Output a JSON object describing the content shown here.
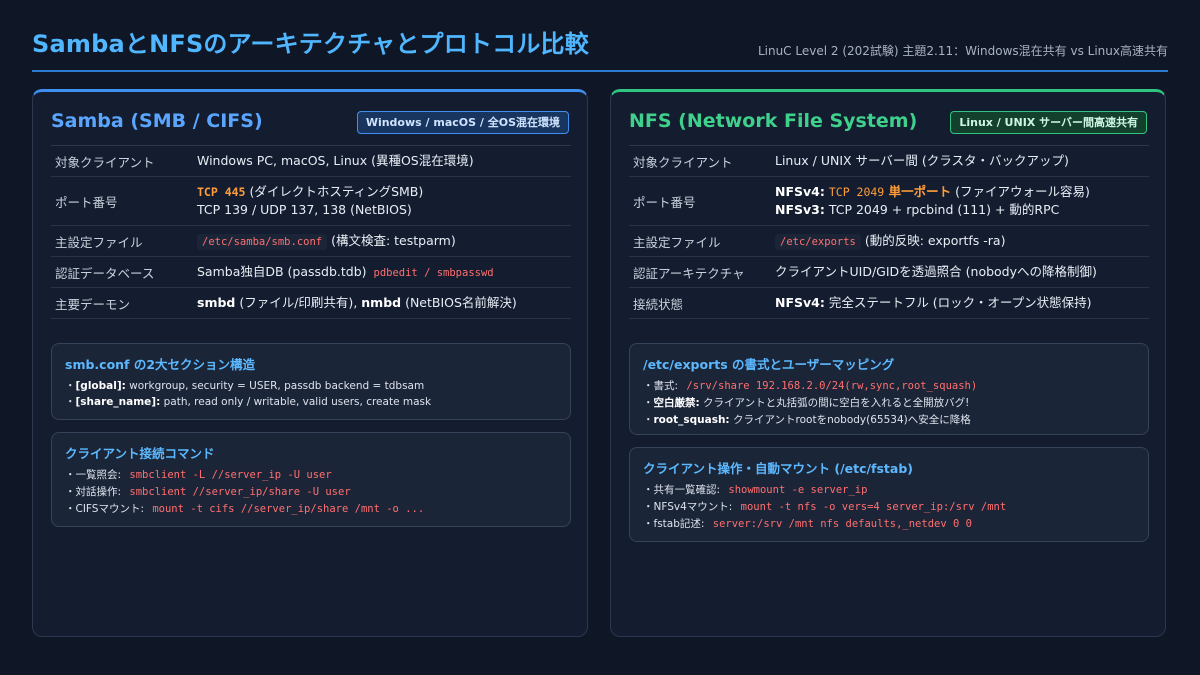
{
  "header": {
    "title": "SambaとNFSのアーキテクチャとプロトコル比較",
    "subtitle": "LinuC Level 2 (202試験) 主題2.11：Windows混在共有 vs Linux高速共有"
  },
  "samba": {
    "title": "Samba (SMB / CIFS)",
    "tag": "Windows / macOS / 全OS混在環境",
    "rows": {
      "client": {
        "key": "対象クライアント",
        "val": "Windows PC, macOS, Linux (異種OS混在環境)"
      },
      "port": {
        "key": "ポート番号",
        "tcp": "TCP 445",
        "tcp_note": " (ダイレクトホスティングSMB)",
        "line2": "TCP 139 / UDP 137, 138 (NetBIOS)"
      },
      "config": {
        "key": "主設定ファイル",
        "code": "/etc/samba/smb.conf",
        "note": " (構文検査: testparm)"
      },
      "auth": {
        "key": "認証データベース",
        "val": "Samba独自DB (passdb.tdb) ",
        "code": "pdbedit / smbpasswd"
      },
      "daemon": {
        "key": "主要デーモン",
        "b1": "smbd",
        "t1": " (ファイル/印刷共有), ",
        "b2": "nmbd",
        "t2": " (NetBIOS名前解決)"
      }
    },
    "box1": {
      "title": "smb.conf の2大セクション構造",
      "l1_label": "[global]:",
      "l1_text": " workgroup, security = USER, passdb backend = tdbsam",
      "l2_label": "[share_name]:",
      "l2_text": " path, read only / writable, valid users, create mask"
    },
    "box2": {
      "title": "クライアント接続コマンド",
      "l1_label": "一覧照会: ",
      "l1_code": "smbclient -L //server_ip -U user",
      "l2_label": "対話操作: ",
      "l2_code": "smbclient //server_ip/share -U user",
      "l3_label": "CIFSマウント: ",
      "l3_code": "mount -t cifs //server_ip/share /mnt -o ..."
    }
  },
  "nfs": {
    "title": "NFS (Network File System)",
    "tag": "Linux / UNIX サーバー間高速共有",
    "rows": {
      "client": {
        "key": "対象クライアント",
        "val": "Linux / UNIX サーバー間 (クラスタ・バックアップ)"
      },
      "port": {
        "key": "ポート番号",
        "v4": "NFSv4:",
        "v4_port": "TCP 2049",
        "v4_single": " 単一ポート",
        "v4_note": " (ファイアウォール容易)",
        "v3": "NFSv3:",
        "v3_text": " TCP 2049 + rpcbind (111) + 動的RPC"
      },
      "config": {
        "key": "主設定ファイル",
        "code": "/etc/exports",
        "note": " (動的反映: exportfs -ra)"
      },
      "auth": {
        "key": "認証アーキテクチャ",
        "val": "クライアントUID/GIDを透過照合 (nobodyへの降格制御)"
      },
      "state": {
        "key": "接続状態",
        "b": "NFSv4:",
        "t": " 完全ステートフル (ロック・オープン状態保持)"
      }
    },
    "box1": {
      "title": "/etc/exports の書式とユーザーマッピング",
      "l1_label": "書式: ",
      "l1_code": "/srv/share 192.168.2.0/24(rw,sync,root_squash)",
      "l2_label": "空白厳禁:",
      "l2_text": " クライアントと丸括弧の間に空白を入れると全開放バグ!",
      "l3_label": "root_squash:",
      "l3_text": " クライアントrootをnobody(65534)へ安全に降格"
    },
    "box2": {
      "title": "クライアント操作・自動マウント (/etc/fstab)",
      "l1_label": "共有一覧確認: ",
      "l1_code": "showmount -e server_ip",
      "l2_label": "NFSv4マウント: ",
      "l2_code": "mount -t nfs -o vers=4 server_ip:/srv /mnt",
      "l3_label": "fstab記述: ",
      "l3_code": "server:/srv /mnt nfs defaults,_netdev 0 0"
    }
  },
  "bullet": "・"
}
